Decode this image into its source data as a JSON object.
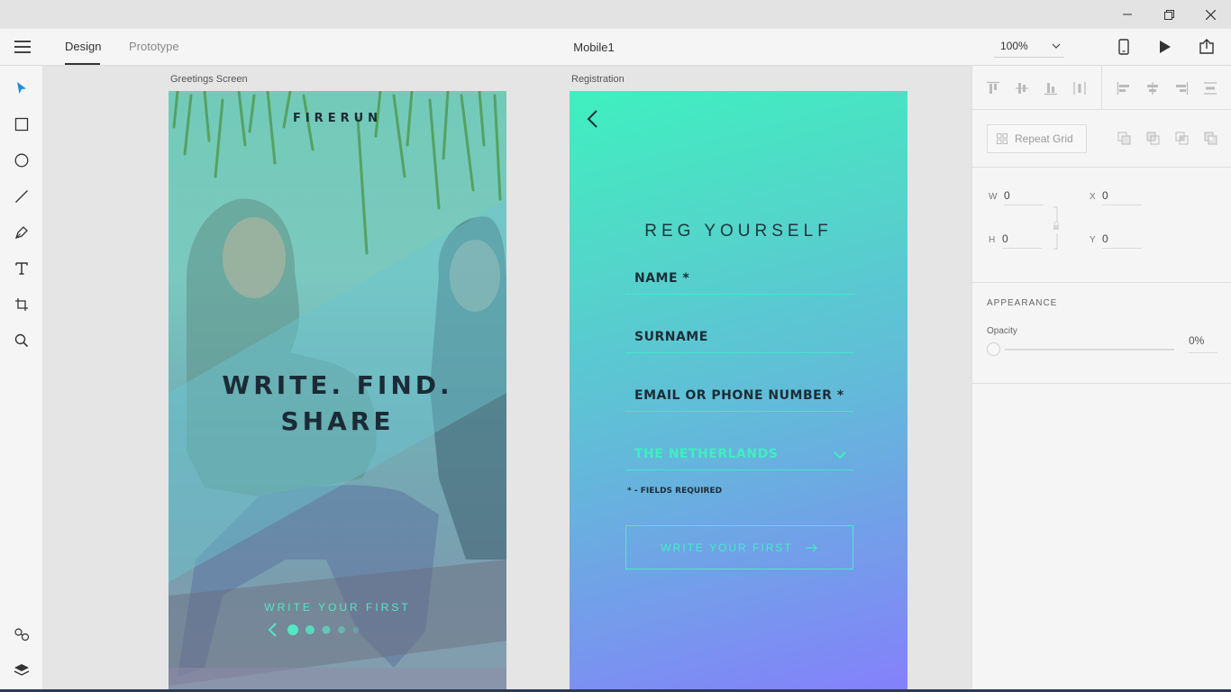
{
  "window": {
    "controls": [
      "minimize-icon",
      "restore-icon",
      "close-icon"
    ]
  },
  "menubar": {
    "tabs": [
      {
        "label": "Design",
        "active": true
      },
      {
        "label": "Prototype",
        "active": false
      }
    ],
    "document_title": "Mobile1",
    "zoom": "100%",
    "icons": [
      "mobile-preview-icon",
      "play-icon",
      "share-icon"
    ]
  },
  "toolbar": {
    "tools": [
      "select-icon",
      "rectangle-icon",
      "ellipse-icon",
      "line-icon",
      "pen-icon",
      "text-icon",
      "artboard-icon",
      "zoom-icon"
    ],
    "bottom": [
      "symbols-icon",
      "layers-icon"
    ]
  },
  "canvas": {
    "greetings": {
      "label": "Greetings Screen",
      "brand": "FIRERUN",
      "headline_line1": "WRITE. FIND.",
      "headline_line2": "SHARE",
      "cta": "WRITE YOUR FIRST",
      "page_count": 5,
      "active_page": 1
    },
    "registration": {
      "label": "Registration",
      "title": "REG YOURSELF",
      "fields": {
        "name": "NAME *",
        "surname": "SURNAME",
        "email": "EMAIL OR PHONE NUMBER  *",
        "country": "THE NETHERLANDS"
      },
      "required_note": "* - FIELDS REQUIRED",
      "button": "WRITE YOUR FIRST"
    }
  },
  "panel": {
    "repeat_grid": "Repeat Grid",
    "w_label": "W",
    "w_value": "0",
    "h_label": "H",
    "h_value": "0",
    "x_label": "X",
    "x_value": "0",
    "y_label": "Y",
    "y_value": "0",
    "appearance_title": "APPEARANCE",
    "opacity_label": "Opacity",
    "opacity_value": "0%"
  },
  "colors": {
    "accent": "#40f0c4",
    "select_tool": "#1c8fdf"
  }
}
